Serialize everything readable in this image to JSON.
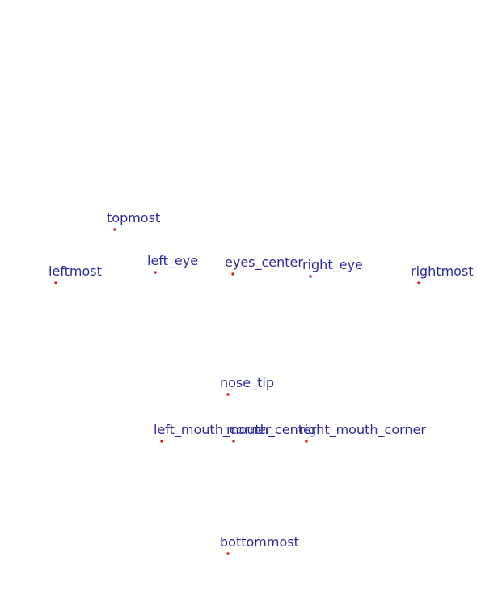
{
  "colors": {
    "background": "#ffffff",
    "label": "#2b2b9a",
    "marker": "#cc1111"
  },
  "landmarks": [
    {
      "id": "topmost",
      "label": "topmost"
    },
    {
      "id": "leftmost",
      "label": "leftmost"
    },
    {
      "id": "left_eye",
      "label": "left_eye"
    },
    {
      "id": "eyes_center",
      "label": "eyes_center"
    },
    {
      "id": "right_eye",
      "label": "right_eye"
    },
    {
      "id": "rightmost",
      "label": "rightmost"
    },
    {
      "id": "nose_tip",
      "label": "nose_tip"
    },
    {
      "id": "left_mouth_corner",
      "label": "left_mouth_corner"
    },
    {
      "id": "mouth_center",
      "label": "mouth_center"
    },
    {
      "id": "right_mouth_corner",
      "label": "right_mouth_corner"
    },
    {
      "id": "bottommost",
      "label": "bottommost"
    }
  ]
}
